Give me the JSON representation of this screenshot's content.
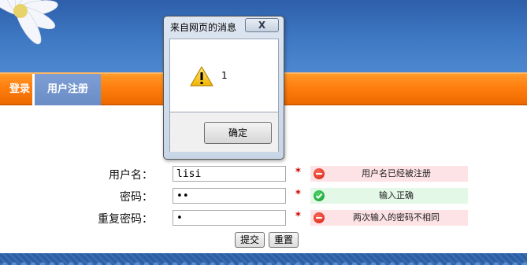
{
  "nav": {
    "login_label": "登录",
    "register_label": "用户注册"
  },
  "form": {
    "rows": [
      {
        "label": "用户名：",
        "value": "lisi",
        "required": "*",
        "status": "error",
        "message": "用户名已经被注册"
      },
      {
        "label": "密码：",
        "value": "••",
        "required": "*",
        "status": "ok",
        "message": "输入正确"
      },
      {
        "label": "重复密码：",
        "value": "•",
        "required": "*",
        "status": "error",
        "message": "两次输入的密码不相同"
      }
    ],
    "submit_label": "提交",
    "reset_label": "重置"
  },
  "dialog": {
    "title": "来自网页的消息",
    "close_label": "X",
    "message": "1",
    "ok_label": "确定"
  },
  "colors": {
    "banner": "#3f79c4",
    "nav": "#ff7f10",
    "nav_active": "#6a8cc6",
    "error_bg": "#fde2e6",
    "ok_bg": "#e3f8e6",
    "required": "#cc0000"
  }
}
